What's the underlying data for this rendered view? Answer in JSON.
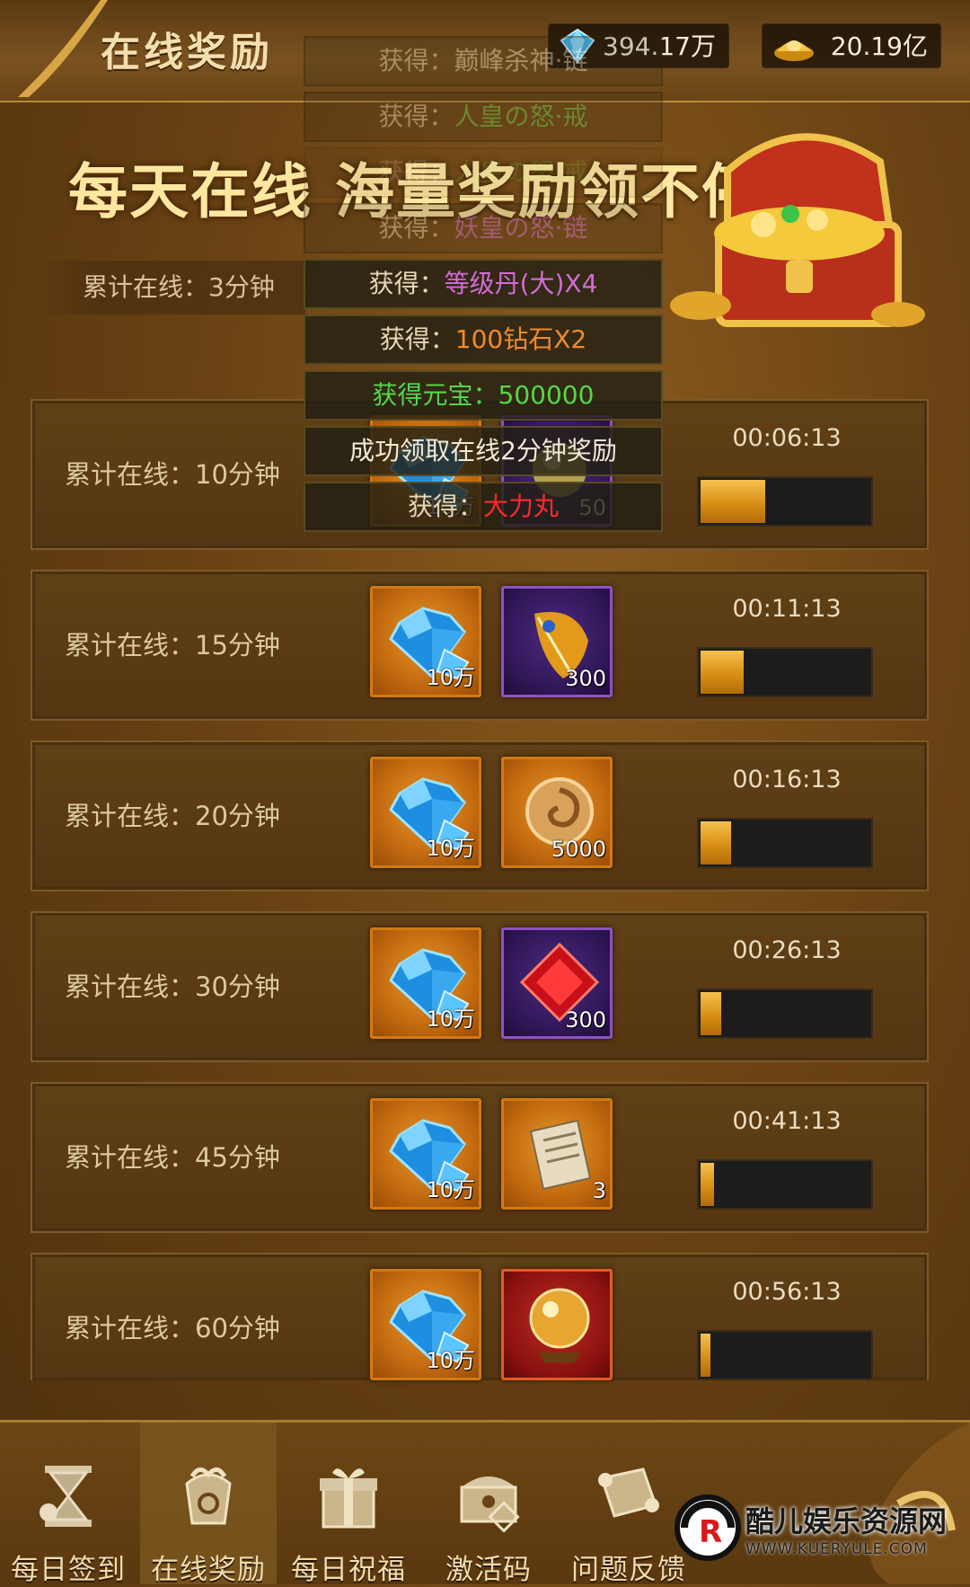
{
  "header": {
    "title": "在线奖励",
    "diamonds": "394.17万",
    "gold": "20.19亿"
  },
  "banner": {
    "headline": "每天在线  海量奖励领不停",
    "cumulative_online": "累计在线：3分钟"
  },
  "log": [
    {
      "label": "获得：",
      "value": "巅峰杀神·链",
      "color": "#e9dcc0",
      "faint": true
    },
    {
      "label": "获得：",
      "value": "人皇の怒·戒",
      "color": "#5fd04a",
      "faint": true
    },
    {
      "label": "获得：",
      "value": "人皇の怒·戒",
      "color": "#5fd04a",
      "faint": true
    },
    {
      "label": "获得：",
      "value": "妖皇の怒·链",
      "color": "#d36bd8",
      "faint": true
    },
    {
      "label": "获得：",
      "value": "等级丹(大)X4",
      "color": "#d36bd8",
      "faint": false
    },
    {
      "label": "获得：",
      "value": "100钻石X2",
      "color": "#f08a2c",
      "faint": false
    },
    {
      "label": "",
      "value": "获得元宝：500000",
      "color": "#54d64a",
      "faint": false
    },
    {
      "label": "",
      "value": "成功领取在线2分钟奖励",
      "color": "#f2ead6",
      "faint": false
    },
    {
      "label": "获得：",
      "value": "大力丸",
      "color": "#ff2a2a",
      "faint": false
    }
  ],
  "rewards": [
    {
      "label": "累计在线：10分钟",
      "timer": "00:06:13",
      "progress": 0.38,
      "item1": {
        "icon": "diamond-icon",
        "qty": "10万"
      },
      "item2": {
        "icon": "orb-icon",
        "qty": "50"
      }
    },
    {
      "label": "累计在线：15分钟",
      "timer": "00:11:13",
      "progress": 0.25,
      "item1": {
        "icon": "diamond-icon",
        "qty": "10万"
      },
      "item2": {
        "icon": "feather-icon",
        "qty": "300"
      }
    },
    {
      "label": "累计在线：20分钟",
      "timer": "00:16:13",
      "progress": 0.18,
      "item1": {
        "icon": "diamond-icon",
        "qty": "10万"
      },
      "item2": {
        "icon": "swirl-coin-icon",
        "qty": "5000"
      }
    },
    {
      "label": "累计在线：30分钟",
      "timer": "00:26:13",
      "progress": 0.12,
      "item1": {
        "icon": "diamond-icon",
        "qty": "10万"
      },
      "item2": {
        "icon": "red-gem-icon",
        "qty": "300"
      }
    },
    {
      "label": "累计在线：45分钟",
      "timer": "00:41:13",
      "progress": 0.08,
      "item1": {
        "icon": "diamond-icon",
        "qty": "10万"
      },
      "item2": {
        "icon": "scroll-icon",
        "qty": "3"
      }
    },
    {
      "label": "累计在线：60分钟",
      "timer": "00:56:13",
      "progress": 0.06,
      "item1": {
        "icon": "diamond-icon",
        "qty": "10万"
      },
      "item2": {
        "icon": "crystal-ball-icon",
        "qty": ""
      }
    }
  ],
  "nav": [
    {
      "label": "每日签到",
      "icon": "hourglass-icon",
      "active": false
    },
    {
      "label": "在线奖励",
      "icon": "gift-pouch-icon",
      "active": true
    },
    {
      "label": "每日祝福",
      "icon": "gift-box-icon",
      "active": false
    },
    {
      "label": "激活码",
      "icon": "chest-icon",
      "active": false
    },
    {
      "label": "问题反馈",
      "icon": "scroll-icon",
      "active": false
    }
  ],
  "watermark": {
    "name": "酷儿娱乐资源网",
    "url": "WWW.KUERYULE.COM"
  },
  "colors": {
    "accent": "#f6c24e",
    "panel": "#5f4016",
    "border": "#7b5a2a"
  }
}
